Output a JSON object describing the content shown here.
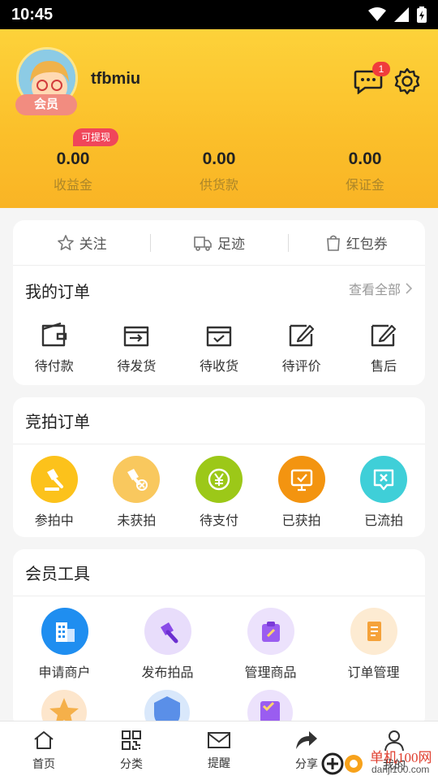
{
  "status_bar": {
    "time": "10:45"
  },
  "profile": {
    "username": "tfbmiu",
    "member_badge": "会员",
    "message_count": "1",
    "withdraw_tag": "可提现",
    "funds": [
      {
        "value": "0.00",
        "label": "收益金"
      },
      {
        "value": "0.00",
        "label": "供货款"
      },
      {
        "value": "0.00",
        "label": "保证金"
      }
    ]
  },
  "quick_links": [
    {
      "label": "关注",
      "icon": "star-icon"
    },
    {
      "label": "足迹",
      "icon": "truck-icon"
    },
    {
      "label": "红包券",
      "icon": "bag-icon"
    }
  ],
  "orders": {
    "title": "我的订单",
    "view_all": "查看全部",
    "items": [
      {
        "label": "待付款",
        "icon": "wallet-icon"
      },
      {
        "label": "待发货",
        "icon": "shipping-box-icon"
      },
      {
        "label": "待收货",
        "icon": "receive-box-icon"
      },
      {
        "label": "待评价",
        "icon": "edit-icon"
      },
      {
        "label": "售后",
        "icon": "after-sale-icon"
      }
    ]
  },
  "auction": {
    "title": "竞拍订单",
    "items": [
      {
        "label": "参拍中",
        "icon": "gavel-icon",
        "color": "#fcc21b"
      },
      {
        "label": "未获拍",
        "icon": "gavel-cancel-icon",
        "color": "#f9c85e"
      },
      {
        "label": "待支付",
        "icon": "yuan-icon",
        "color": "#9cc818"
      },
      {
        "label": "已获拍",
        "icon": "certificate-icon",
        "color": "#f39410"
      },
      {
        "label": "已流拍",
        "icon": "failed-icon",
        "color": "#3fcfd8"
      }
    ]
  },
  "member_tools": {
    "title": "会员工具",
    "items": [
      {
        "label": "申请商户",
        "icon": "building-icon",
        "color": "#1f8ef0"
      },
      {
        "label": "发布拍品",
        "icon": "gavel-publish-icon",
        "color": "#8a4be8"
      },
      {
        "label": "管理商品",
        "icon": "clipboard-icon",
        "color": "#9a5df0"
      },
      {
        "label": "订单管理",
        "icon": "order-doc-icon",
        "color": "#f5a23a"
      }
    ]
  },
  "tabbar": [
    {
      "label": "首页",
      "icon": "home-icon"
    },
    {
      "label": "分类",
      "icon": "grid-qr-icon"
    },
    {
      "label": "提醒",
      "icon": "mail-icon"
    },
    {
      "label": "分享",
      "icon": "share-icon"
    },
    {
      "label": "我的",
      "icon": "user-icon"
    }
  ],
  "watermark": {
    "text": "单机100网",
    "sub": "danji100.com"
  }
}
